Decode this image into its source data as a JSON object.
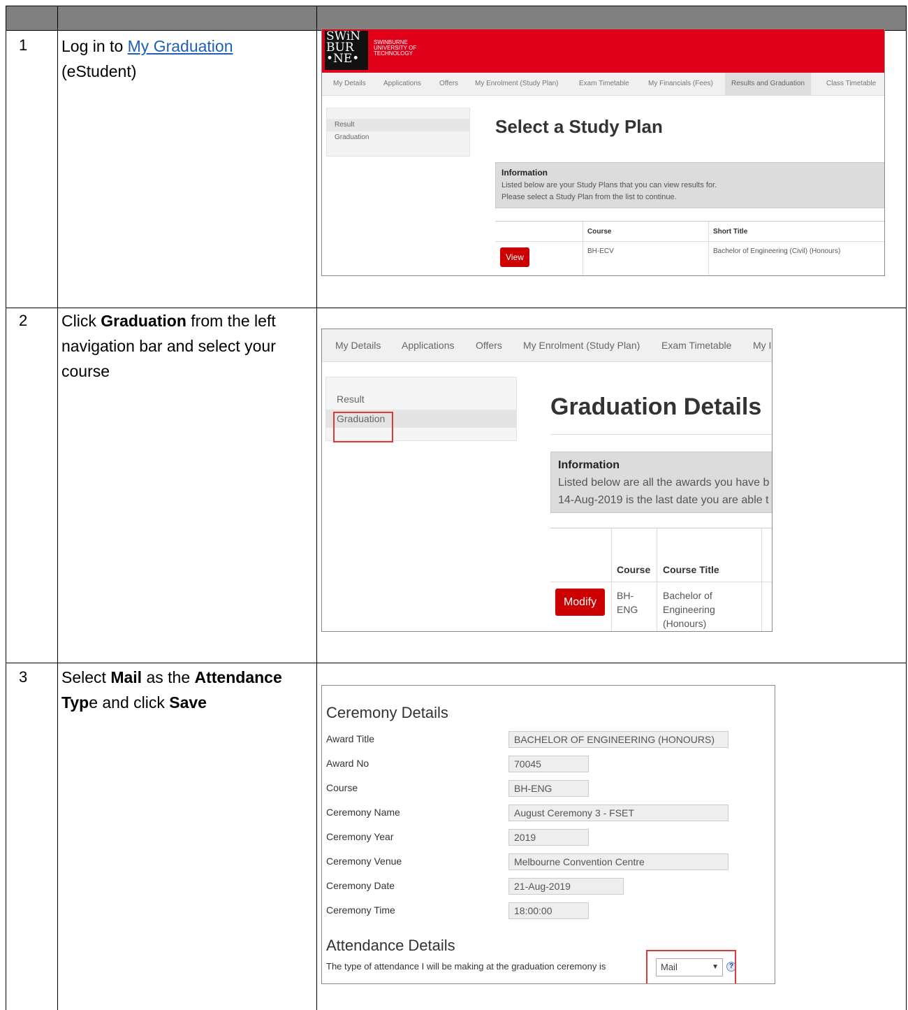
{
  "steps": [
    {
      "num": "1",
      "text_before": "Log in to ",
      "link": "My Graduation",
      "text_after": "(eStudent)"
    },
    {
      "num": "2",
      "text_before": "Click ",
      "bold": "Graduation",
      "text_after": "  from the left navigation bar and select your course"
    },
    {
      "num": "3",
      "text_a": "Select ",
      "bold_a": "Mail",
      "text_b": " as the ",
      "bold_b": "Attendance Typ",
      "text_c": "e and click ",
      "bold_c": "Save"
    }
  ],
  "shot1": {
    "logo": "SWiN BUR •NE•",
    "logo_sub": "SWINBURNE UNIVERSITY OF TECHNOLOGY",
    "nav": [
      "My Details",
      "Applications",
      "Offers",
      "My Enrolment (Study Plan)",
      "Exam Timetable",
      "My Financials (Fees)",
      "Results and Graduation",
      "Class Timetable"
    ],
    "side": [
      "Result",
      "Graduation"
    ],
    "heading": "Select a Study Plan",
    "info_title": "Information",
    "info_lines": [
      "Listed below are your Study Plans that you can view results for.",
      "Please select a Study Plan from the list to continue."
    ],
    "col_course": "Course",
    "col_short": "Short Title",
    "view_btn": "View",
    "course": "BH-ECV",
    "short_title": "Bachelor of Engineering (Civil) (Honours)"
  },
  "shot2": {
    "nav": [
      "My Details",
      "Applications",
      "Offers",
      "My Enrolment (Study Plan)",
      "Exam Timetable",
      "My I"
    ],
    "side": [
      "Result",
      "Graduation"
    ],
    "heading": "Graduation Details",
    "info_title": "Information",
    "info_lines": [
      "Listed below are all the awards you have b",
      "14-Aug-2019 is the last date you are able t"
    ],
    "col_course": "Course",
    "col_title": "Course Title",
    "modify_btn": "Modify",
    "course_lines": [
      "BH-",
      "ENG"
    ],
    "title_lines": [
      "Bachelor of",
      "Engineering",
      "(Honours)"
    ]
  },
  "shot3": {
    "section1": "Ceremony Details",
    "fields": [
      {
        "label": "Award Title",
        "value": "BACHELOR OF ENGINEERING (HONOURS)"
      },
      {
        "label": "Award No",
        "value": "70045"
      },
      {
        "label": "Course",
        "value": "BH-ENG"
      },
      {
        "label": "Ceremony Name",
        "value": "August Ceremony 3 - FSET"
      },
      {
        "label": "Ceremony Year",
        "value": "2019"
      },
      {
        "label": "Ceremony Venue",
        "value": "Melbourne Convention Centre"
      },
      {
        "label": "Ceremony Date",
        "value": "21-Aug-2019"
      },
      {
        "label": "Ceremony Time",
        "value": "18:00:00"
      }
    ],
    "section2": "Attendance Details",
    "attendance_label": "The type of attendance I will be making at the graduation ceremony is",
    "attendance_value": "Mail",
    "help": "?"
  },
  "colors": {
    "header": "#808080",
    "red": "#e0001a",
    "button": "#cc0000",
    "highlight": "#e0383b",
    "link": "#1f5fb5"
  }
}
